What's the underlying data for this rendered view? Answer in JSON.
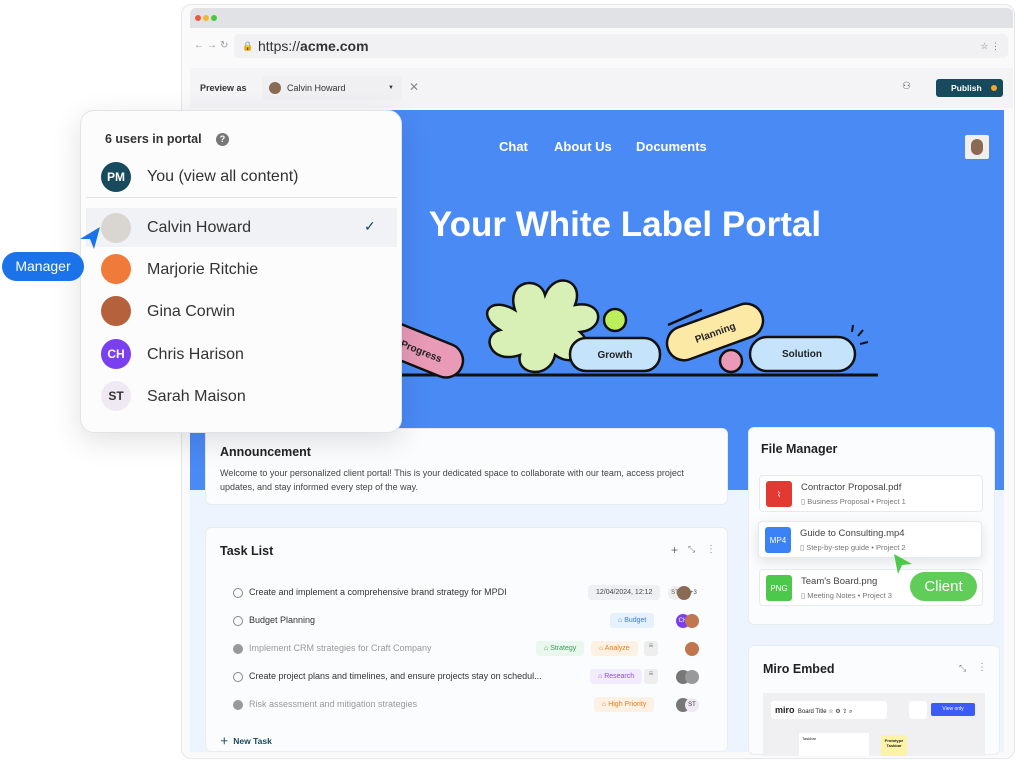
{
  "browser": {
    "url_prefix": "https://",
    "url_domain": "acme.com"
  },
  "preview_bar": {
    "label": "Preview as",
    "selected_user": "Calvin Howard",
    "publish_label": "Publish"
  },
  "hero": {
    "nav": [
      "Chat",
      "About Us",
      "Documents"
    ],
    "title": "Your White Label Portal",
    "pills": [
      "Progress",
      "Growth",
      "Planning",
      "Solution"
    ],
    "color": "#4a8af5"
  },
  "user_dropdown": {
    "header": "6 users in portal",
    "you": {
      "initials": "PM",
      "label": "You (view all content)"
    },
    "users": [
      {
        "name": "Calvin Howard",
        "selected": true,
        "initials": ""
      },
      {
        "name": "Marjorie Ritchie",
        "initials": ""
      },
      {
        "name": "Gina Corwin",
        "initials": ""
      },
      {
        "name": "Chris Harison",
        "initials": "CH"
      },
      {
        "name": "Sarah Maison",
        "initials": "ST"
      }
    ]
  },
  "cursor_labels": {
    "manager": "Manager",
    "client": "Client"
  },
  "announcement": {
    "title": "Announcement",
    "body": "Welcome to your personalized client portal! This is your dedicated space to collaborate with our team, access project updates, and stay informed every step of the way."
  },
  "task_list": {
    "title": "Task List",
    "new_task": "New Task",
    "tasks": [
      {
        "text": "Create and implement a comprehensive brand strategy for MPDI",
        "done": false,
        "date": "12/04/2024, 12:12",
        "extra": "+3"
      },
      {
        "text": "Budget Planning",
        "done": false,
        "tags": [
          "Budget"
        ]
      },
      {
        "text": "Implement CRM strategies for Craft Company",
        "done": true,
        "tags": [
          "Strategy",
          "Analyze"
        ]
      },
      {
        "text": "Create project plans and timelines, and ensure projects stay on schedul...",
        "done": false,
        "tags": [
          "Research"
        ]
      },
      {
        "text": "Risk assessment and mitigation strategies",
        "done": true,
        "tags": [
          "High Priority"
        ],
        "avatar": "ST"
      }
    ]
  },
  "file_manager": {
    "title": "File Manager",
    "files": [
      {
        "name": "Contractor Proposal.pdf",
        "type": "PDF",
        "category": "Business Proposal",
        "project": "Project 1"
      },
      {
        "name": "Guide to Consulting.mp4",
        "type": "MP4",
        "category": "Step-by-step guide",
        "project": "Project 2"
      },
      {
        "name": "Team's Board.png",
        "type": "PNG",
        "category": "Meeting Notes",
        "project": "Project 3"
      }
    ]
  },
  "miro": {
    "title": "Miro Embed",
    "logo": "miro",
    "board_title": "Board Title",
    "view_only": "View only",
    "sticky": "Prototype Taskbar",
    "frame": "Taskbar"
  }
}
